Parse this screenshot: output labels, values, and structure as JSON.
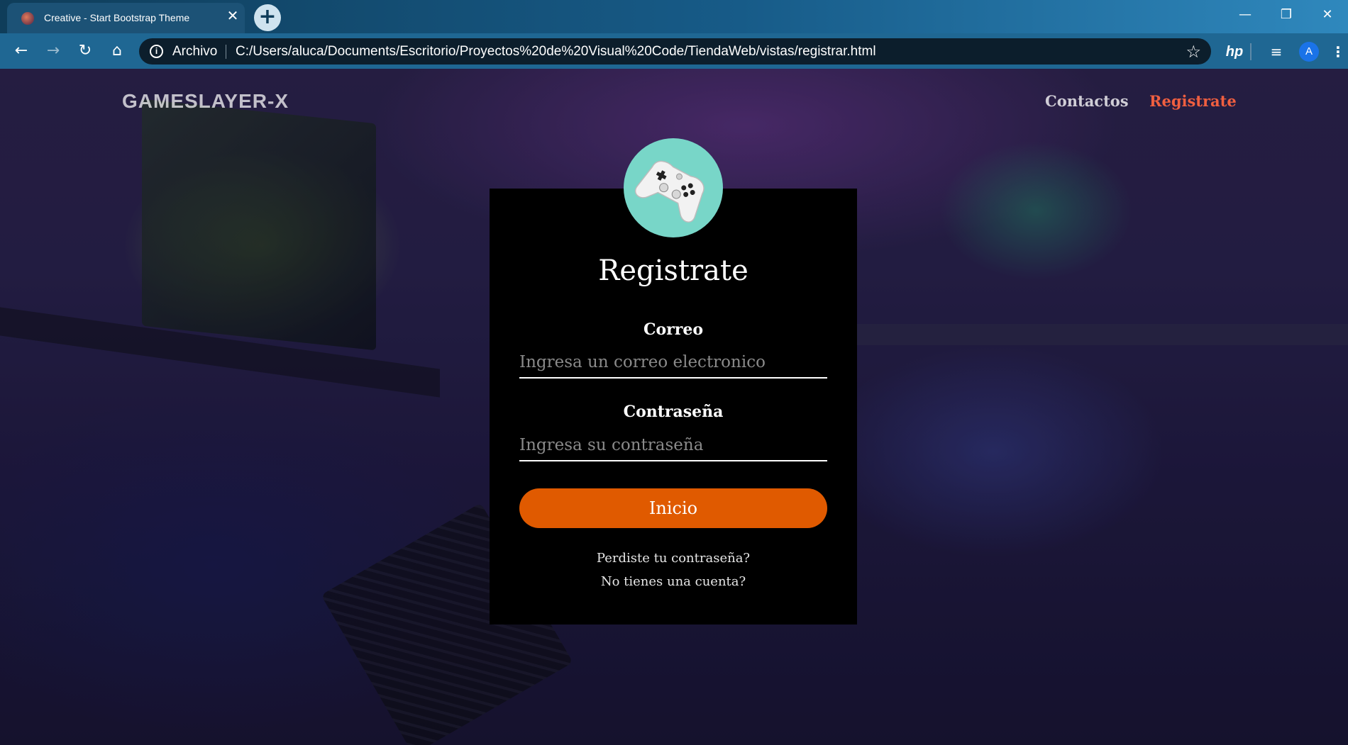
{
  "browser": {
    "tab_title": "Creative - Start Bootstrap Theme",
    "tab_close": "✕",
    "new_tab": "+",
    "omnibox_scheme": "Archivo",
    "omnibox_url": "C:/Users/aluca/Documents/Escritorio/Proyectos%20de%20Visual%20Code/TiendaWeb/vistas/registrar.html",
    "profile_initial": "A",
    "ext_hp": "hp",
    "icons": {
      "back": "←",
      "forward": "→",
      "reload": "↻",
      "home": "⌂",
      "info": "i",
      "star": "☆",
      "media": "≡",
      "menu": "⋮",
      "minimize": "—",
      "restore": "❐",
      "close": "✕"
    }
  },
  "page": {
    "brand": "GAMESLAYER-X",
    "nav": {
      "contactos": "Contactos",
      "registrate": "Registrate"
    },
    "form": {
      "title": "Registrate",
      "email_label": "Correo",
      "email_placeholder": "Ingresa un correo electronico",
      "password_label": "Contraseña",
      "password_placeholder": "Ingresa su contraseña",
      "submit": "Inicio",
      "forgot_link": "Perdiste tu contraseña?",
      "signup_link": "No tienes una cuenta?"
    }
  },
  "colors": {
    "accent_nav": "#f05f40",
    "button": "#e05a00",
    "avatar_bg": "#78d6c8",
    "card_bg": "#000000"
  }
}
